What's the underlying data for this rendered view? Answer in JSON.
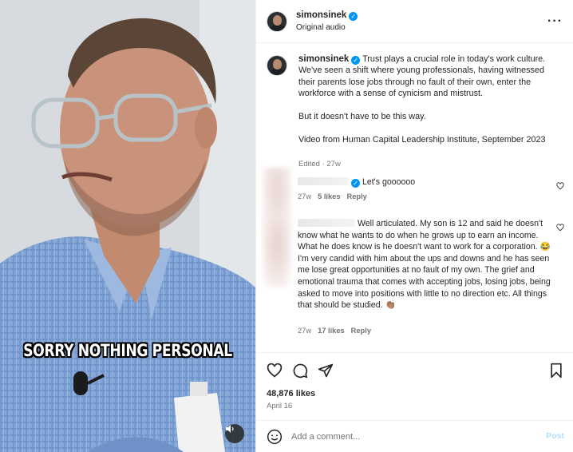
{
  "media": {
    "caption_overlay": "SORRY NOTHING PERSONAL",
    "audio_icon": "speaker-icon"
  },
  "header": {
    "username": "simonsinek",
    "subtitle": "Original audio",
    "more_icon": "more-horizontal-icon"
  },
  "post": {
    "username": "simonsinek",
    "caption": "Trust plays a crucial role in today's work culture. We've seen a shift where young professionals, having witnessed their parents lose jobs through no fault of their own, enter the workforce with a sense of cynicism and mistrust.\n\nBut it doesn't have to be this way.\n\nVideo from Human Capital Leadership Institute, September 2023",
    "edited": "Edited",
    "age": "27w"
  },
  "comments": [
    {
      "text": "Let's goooooo",
      "age": "27w",
      "likes": "5 likes",
      "reply": "Reply"
    },
    {
      "text": "Well articulated. My son is 12 and said he doesn't know what he wants to do when he grows up to earn an income. What he does know is he doesn't want to work for a corporation. 😂 I'm very candid with him about the ups and downs and he has seen me lose great opportunities at no fault of my own. The grief and emotional trauma that comes with accepting jobs, losing jobs, being asked to move into positions with little to no direction etc. All things that should be studied. 👏🏽",
      "age": "27w",
      "likes": "17 likes",
      "reply": "Reply"
    }
  ],
  "actions": {
    "like_icon": "heart-icon",
    "comment_icon": "comment-icon",
    "share_icon": "send-icon",
    "save_icon": "bookmark-icon",
    "likes": "48,876 likes",
    "date": "April 16"
  },
  "composer": {
    "emoji_icon": "emoji-icon",
    "placeholder": "Add a comment...",
    "post_label": "Post"
  }
}
